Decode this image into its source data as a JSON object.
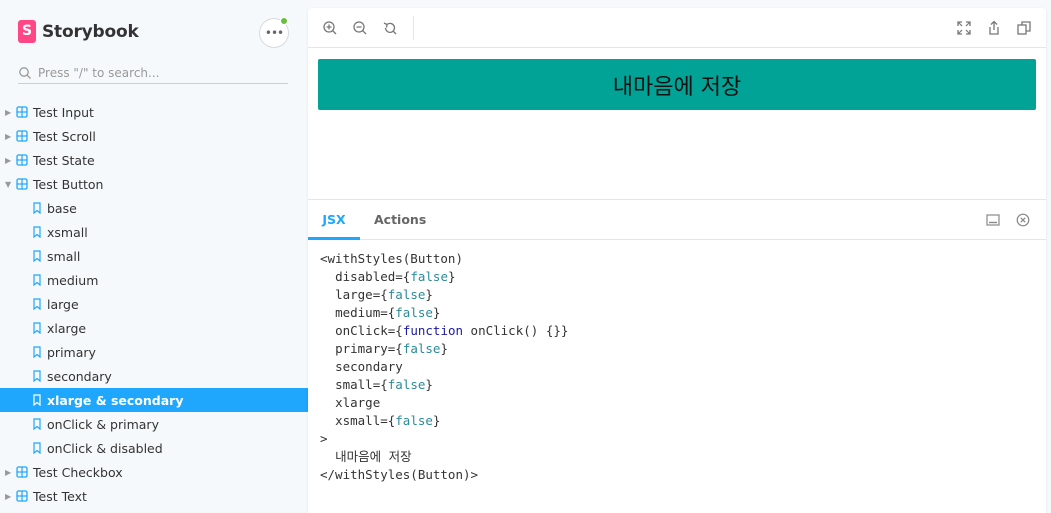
{
  "brand": {
    "name": "Storybook",
    "logo_letter": "S"
  },
  "menu": {
    "icon": "ellipsis-icon",
    "label": "•••"
  },
  "search": {
    "placeholder": "Press \"/\" to search..."
  },
  "tree": {
    "groups_before": [
      {
        "label": "Test Input"
      },
      {
        "label": "Test Scroll"
      },
      {
        "label": "Test State"
      }
    ],
    "expanded": {
      "label": "Test Button"
    },
    "stories": [
      {
        "label": "base"
      },
      {
        "label": "xsmall"
      },
      {
        "label": "small"
      },
      {
        "label": "medium"
      },
      {
        "label": "large"
      },
      {
        "label": "xlarge"
      },
      {
        "label": "primary"
      },
      {
        "label": "secondary"
      },
      {
        "label": "xlarge & secondary",
        "selected": true
      },
      {
        "label": "onClick & primary"
      },
      {
        "label": "onClick & disabled"
      }
    ],
    "groups_after": [
      {
        "label": "Test Checkbox"
      },
      {
        "label": "Test Text"
      }
    ]
  },
  "toolbar": {
    "left": [
      "zoom-in-icon",
      "zoom-out-icon",
      "reset-zoom-icon"
    ],
    "right": [
      "fullscreen-icon",
      "share-icon",
      "copy-icon"
    ]
  },
  "preview": {
    "button_label": "내마음에 저장",
    "button_color": "#00a396"
  },
  "addons": {
    "tabs": [
      {
        "label": "JSX",
        "active": true
      },
      {
        "label": "Actions",
        "active": false
      }
    ],
    "icons": [
      "panel-position-icon",
      "close-icon"
    ]
  },
  "jsx": {
    "open_tag": "<withStyles(Button)",
    "props": [
      {
        "name": "disabled",
        "value": "false"
      },
      {
        "name": "large",
        "value": "false"
      },
      {
        "name": "medium",
        "value": "false"
      },
      {
        "name": "onClick",
        "value": "function onClick() {}"
      },
      {
        "name": "primary",
        "value": "false"
      },
      {
        "name": "secondary",
        "value": null
      },
      {
        "name": "small",
        "value": "false"
      },
      {
        "name": "xlarge",
        "value": null
      },
      {
        "name": "xsmall",
        "value": "false"
      }
    ],
    "close_open": ">",
    "children": "내마음에 저장",
    "close_tag": "</withStyles(Button)>"
  },
  "colors": {
    "accent": "#1ea7fd",
    "brand": "#ff4785",
    "status_dot": "#66bf3c"
  }
}
